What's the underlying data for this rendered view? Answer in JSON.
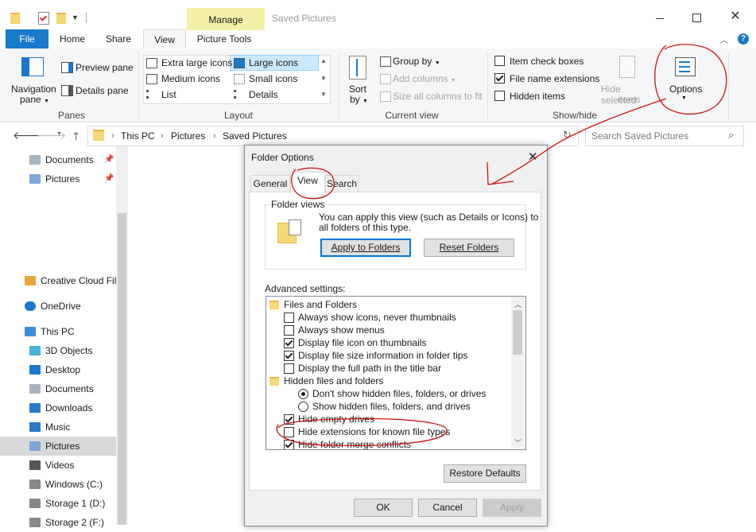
{
  "titlebar": {
    "manage": "Manage",
    "title": "Saved Pictures"
  },
  "ribbon_tabs": {
    "file": "File",
    "home": "Home",
    "share": "Share",
    "view": "View",
    "picture_tools": "Picture Tools"
  },
  "panes": {
    "navigation_pane": "Navigation",
    "navigation_pane2": "pane",
    "preview_pane": "Preview pane",
    "details_pane": "Details pane",
    "group_label": "Panes"
  },
  "layout": {
    "extra_large": "Extra large icons",
    "large": "Large icons",
    "medium": "Medium icons",
    "small": "Small icons",
    "list": "List",
    "details": "Details",
    "group_label": "Layout"
  },
  "current_view": {
    "sort": "Sort",
    "sort2": "by",
    "group_by": "Group by",
    "add_columns": "Add columns",
    "size_all": "Size all columns to fit",
    "group_label": "Current view"
  },
  "show_hide": {
    "item_checkboxes": "Item check boxes",
    "file_name_ext": "File name extensions",
    "hidden_items": "Hidden items",
    "hide_selected": "Hide selected",
    "hide_selected2": "items",
    "options": "Options",
    "group_label": "Show/hide"
  },
  "address": {
    "crumbs": [
      "This PC",
      "Pictures",
      "Saved Pictures"
    ],
    "search_placeholder": "Search Saved Pictures"
  },
  "nav": [
    {
      "label": "Documents",
      "icon": "documents-icon",
      "pinned": true
    },
    {
      "label": "Pictures",
      "icon": "pictures-icon",
      "pinned": true
    },
    {
      "label": "Creative Cloud Fil",
      "icon": "creative-cloud-icon"
    },
    {
      "label": "OneDrive",
      "icon": "onedrive-icon"
    },
    {
      "label": "This PC",
      "icon": "this-pc-icon"
    },
    {
      "label": "3D Objects",
      "icon": "3d-objects-icon"
    },
    {
      "label": "Desktop",
      "icon": "desktop-icon"
    },
    {
      "label": "Documents",
      "icon": "documents-icon"
    },
    {
      "label": "Downloads",
      "icon": "downloads-icon"
    },
    {
      "label": "Music",
      "icon": "music-icon"
    },
    {
      "label": "Pictures",
      "icon": "pictures-icon",
      "selected": true
    },
    {
      "label": "Videos",
      "icon": "videos-icon"
    },
    {
      "label": "Windows (C:)",
      "icon": "drive-icon"
    },
    {
      "label": "Storage 1 (D:)",
      "icon": "drive-icon"
    },
    {
      "label": "Storage 2 (F:)",
      "icon": "drive-icon"
    }
  ],
  "dialog": {
    "title": "Folder Options",
    "tabs": {
      "general": "General",
      "view": "View",
      "search": "Search"
    },
    "folder_views": {
      "legend": "Folder views",
      "text1": "You can apply this view (such as Details or Icons) to",
      "text2": "all folders of this type.",
      "apply": "Apply to Folders",
      "reset": "Reset Folders"
    },
    "advanced_label": "Advanced settings:",
    "tree": [
      {
        "type": "folder",
        "label": "Files and Folders"
      },
      {
        "type": "check",
        "checked": false,
        "label": "Always show icons, never thumbnails"
      },
      {
        "type": "check",
        "checked": false,
        "label": "Always show menus"
      },
      {
        "type": "check",
        "checked": true,
        "label": "Display file icon on thumbnails"
      },
      {
        "type": "check",
        "checked": true,
        "label": "Display file size information in folder tips"
      },
      {
        "type": "check",
        "checked": false,
        "label": "Display the full path in the title bar"
      },
      {
        "type": "folder",
        "label": "Hidden files and folders"
      },
      {
        "type": "radio",
        "checked": true,
        "label": "Don't show hidden files, folders, or drives"
      },
      {
        "type": "radio",
        "checked": false,
        "label": "Show hidden files, folders, and drives"
      },
      {
        "type": "check",
        "checked": true,
        "label": "Hide empty drives"
      },
      {
        "type": "check",
        "checked": false,
        "label": "Hide extensions for known file types"
      },
      {
        "type": "check",
        "checked": true,
        "label": "Hide folder merge conflicts"
      }
    ],
    "restore": "Restore Defaults",
    "ok": "OK",
    "cancel": "Cancel",
    "apply": "Apply"
  },
  "colors": {
    "accent": "#1979ca",
    "manage_tab": "#f5f0a8",
    "annotation": "#cc1010",
    "selected_row": "#cce8ff"
  }
}
